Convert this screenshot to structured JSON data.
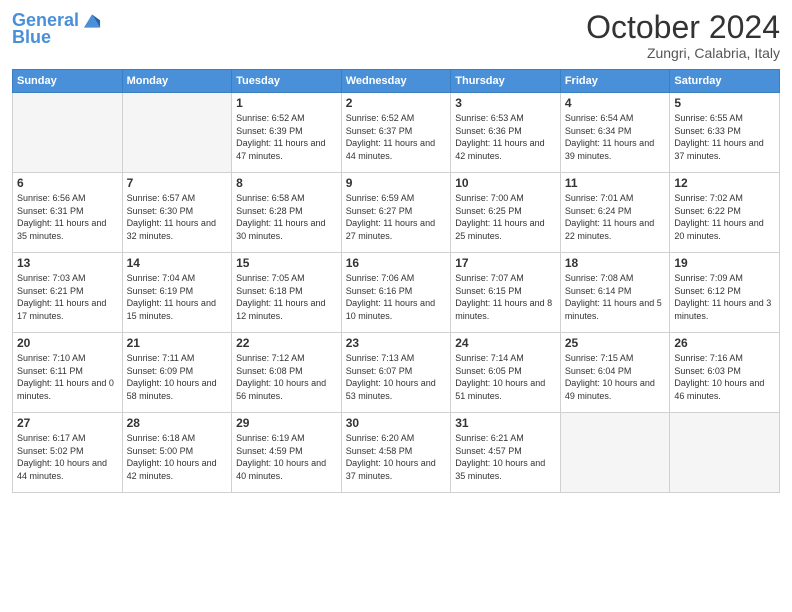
{
  "header": {
    "logo_line1": "General",
    "logo_line2": "Blue",
    "month": "October 2024",
    "location": "Zungri, Calabria, Italy"
  },
  "days_of_week": [
    "Sunday",
    "Monday",
    "Tuesday",
    "Wednesday",
    "Thursday",
    "Friday",
    "Saturday"
  ],
  "weeks": [
    [
      {
        "day": "",
        "info": ""
      },
      {
        "day": "",
        "info": ""
      },
      {
        "day": "1",
        "info": "Sunrise: 6:52 AM\nSunset: 6:39 PM\nDaylight: 11 hours and 47 minutes."
      },
      {
        "day": "2",
        "info": "Sunrise: 6:52 AM\nSunset: 6:37 PM\nDaylight: 11 hours and 44 minutes."
      },
      {
        "day": "3",
        "info": "Sunrise: 6:53 AM\nSunset: 6:36 PM\nDaylight: 11 hours and 42 minutes."
      },
      {
        "day": "4",
        "info": "Sunrise: 6:54 AM\nSunset: 6:34 PM\nDaylight: 11 hours and 39 minutes."
      },
      {
        "day": "5",
        "info": "Sunrise: 6:55 AM\nSunset: 6:33 PM\nDaylight: 11 hours and 37 minutes."
      }
    ],
    [
      {
        "day": "6",
        "info": "Sunrise: 6:56 AM\nSunset: 6:31 PM\nDaylight: 11 hours and 35 minutes."
      },
      {
        "day": "7",
        "info": "Sunrise: 6:57 AM\nSunset: 6:30 PM\nDaylight: 11 hours and 32 minutes."
      },
      {
        "day": "8",
        "info": "Sunrise: 6:58 AM\nSunset: 6:28 PM\nDaylight: 11 hours and 30 minutes."
      },
      {
        "day": "9",
        "info": "Sunrise: 6:59 AM\nSunset: 6:27 PM\nDaylight: 11 hours and 27 minutes."
      },
      {
        "day": "10",
        "info": "Sunrise: 7:00 AM\nSunset: 6:25 PM\nDaylight: 11 hours and 25 minutes."
      },
      {
        "day": "11",
        "info": "Sunrise: 7:01 AM\nSunset: 6:24 PM\nDaylight: 11 hours and 22 minutes."
      },
      {
        "day": "12",
        "info": "Sunrise: 7:02 AM\nSunset: 6:22 PM\nDaylight: 11 hours and 20 minutes."
      }
    ],
    [
      {
        "day": "13",
        "info": "Sunrise: 7:03 AM\nSunset: 6:21 PM\nDaylight: 11 hours and 17 minutes."
      },
      {
        "day": "14",
        "info": "Sunrise: 7:04 AM\nSunset: 6:19 PM\nDaylight: 11 hours and 15 minutes."
      },
      {
        "day": "15",
        "info": "Sunrise: 7:05 AM\nSunset: 6:18 PM\nDaylight: 11 hours and 12 minutes."
      },
      {
        "day": "16",
        "info": "Sunrise: 7:06 AM\nSunset: 6:16 PM\nDaylight: 11 hours and 10 minutes."
      },
      {
        "day": "17",
        "info": "Sunrise: 7:07 AM\nSunset: 6:15 PM\nDaylight: 11 hours and 8 minutes."
      },
      {
        "day": "18",
        "info": "Sunrise: 7:08 AM\nSunset: 6:14 PM\nDaylight: 11 hours and 5 minutes."
      },
      {
        "day": "19",
        "info": "Sunrise: 7:09 AM\nSunset: 6:12 PM\nDaylight: 11 hours and 3 minutes."
      }
    ],
    [
      {
        "day": "20",
        "info": "Sunrise: 7:10 AM\nSunset: 6:11 PM\nDaylight: 11 hours and 0 minutes."
      },
      {
        "day": "21",
        "info": "Sunrise: 7:11 AM\nSunset: 6:09 PM\nDaylight: 10 hours and 58 minutes."
      },
      {
        "day": "22",
        "info": "Sunrise: 7:12 AM\nSunset: 6:08 PM\nDaylight: 10 hours and 56 minutes."
      },
      {
        "day": "23",
        "info": "Sunrise: 7:13 AM\nSunset: 6:07 PM\nDaylight: 10 hours and 53 minutes."
      },
      {
        "day": "24",
        "info": "Sunrise: 7:14 AM\nSunset: 6:05 PM\nDaylight: 10 hours and 51 minutes."
      },
      {
        "day": "25",
        "info": "Sunrise: 7:15 AM\nSunset: 6:04 PM\nDaylight: 10 hours and 49 minutes."
      },
      {
        "day": "26",
        "info": "Sunrise: 7:16 AM\nSunset: 6:03 PM\nDaylight: 10 hours and 46 minutes."
      }
    ],
    [
      {
        "day": "27",
        "info": "Sunrise: 6:17 AM\nSunset: 5:02 PM\nDaylight: 10 hours and 44 minutes."
      },
      {
        "day": "28",
        "info": "Sunrise: 6:18 AM\nSunset: 5:00 PM\nDaylight: 10 hours and 42 minutes."
      },
      {
        "day": "29",
        "info": "Sunrise: 6:19 AM\nSunset: 4:59 PM\nDaylight: 10 hours and 40 minutes."
      },
      {
        "day": "30",
        "info": "Sunrise: 6:20 AM\nSunset: 4:58 PM\nDaylight: 10 hours and 37 minutes."
      },
      {
        "day": "31",
        "info": "Sunrise: 6:21 AM\nSunset: 4:57 PM\nDaylight: 10 hours and 35 minutes."
      },
      {
        "day": "",
        "info": ""
      },
      {
        "day": "",
        "info": ""
      }
    ]
  ]
}
